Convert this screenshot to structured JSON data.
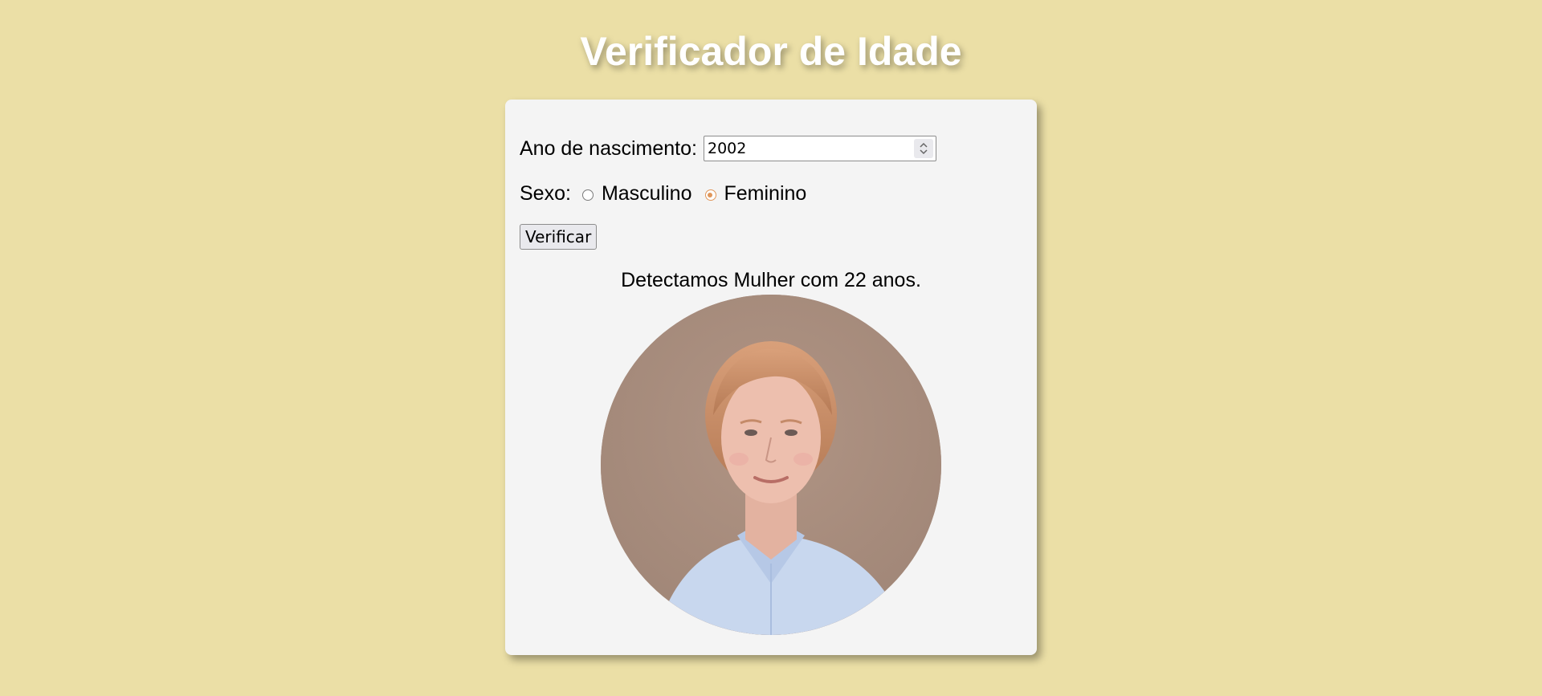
{
  "page": {
    "title": "Verificador de Idade"
  },
  "form": {
    "year_label": "Ano de nascimento:",
    "year_value": "2002",
    "sex_label": "Sexo:",
    "options": [
      {
        "label": "Masculino",
        "selected": false
      },
      {
        "label": "Feminino",
        "selected": true
      }
    ],
    "verify_label": "Verificar"
  },
  "result": {
    "text": "Detectamos Mulher com 22 anos."
  },
  "colors": {
    "background": "#ebdfa6",
    "card": "#f4f4f4",
    "radio_accent": "#e0965a"
  },
  "icons": [
    "spinner-arrows-icon",
    "radio-unchecked-icon",
    "radio-checked-icon"
  ]
}
